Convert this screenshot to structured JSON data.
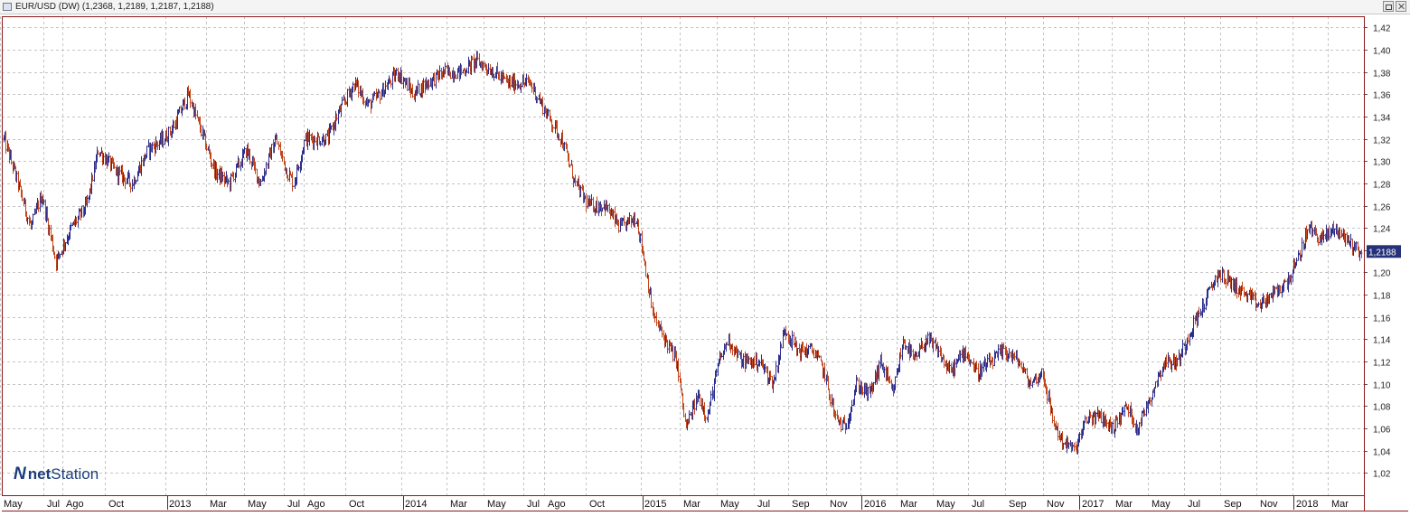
{
  "window": {
    "title": "EUR/USD (DW) (1,2368, 1,2189, 1,2187, 1,2188)"
  },
  "logo": {
    "mark": "N",
    "text_bold": "net",
    "text": "Station"
  },
  "colors": {
    "up_bar": "#2b2f8f",
    "down_bar": "#c2461c",
    "grid": "#c4c4c4",
    "frame": "#8b1a1a",
    "price_label_bg": "#25327a"
  },
  "chart_data": {
    "type": "ohlc",
    "symbol": "EUR/USD (DW)",
    "ohlc_last": {
      "open": 1.2368,
      "high": 1.2189,
      "low": 1.2187,
      "close": 1.2188
    },
    "last_price_label": "1,2188",
    "ylim": [
      1.0,
      1.43
    ],
    "y_ticks": [
      "1,02",
      "1,04",
      "1,06",
      "1,08",
      "1,10",
      "1,12",
      "1,14",
      "1,16",
      "1,18",
      "1,20",
      "1,22",
      "1,24",
      "1,26",
      "1,28",
      "1,30",
      "1,32",
      "1,34",
      "1,36",
      "1,38",
      "1,40",
      "1,42"
    ],
    "grid": true,
    "x_ticks": [
      "May",
      "Jul",
      "Ago",
      "Oct",
      "2013",
      "Mar",
      "May",
      "Jul",
      "Ago",
      "Oct",
      "2014",
      "Mar",
      "May",
      "Jul",
      "Ago",
      "Oct",
      "2015",
      "Mar",
      "May",
      "Jul",
      "Sep",
      "Nov",
      "2016",
      "Mar",
      "May",
      "Jul",
      "Sep",
      "Nov",
      "2017",
      "Mar",
      "May",
      "Jul",
      "Sep",
      "Nov",
      "2018",
      "Mar"
    ],
    "keypoints": [
      [
        0.0,
        1.32
      ],
      [
        0.012,
        1.29
      ],
      [
        0.03,
        1.24
      ],
      [
        0.042,
        1.27
      ],
      [
        0.058,
        1.21
      ],
      [
        0.075,
        1.24
      ],
      [
        0.092,
        1.26
      ],
      [
        0.105,
        1.31
      ],
      [
        0.125,
        1.29
      ],
      [
        0.143,
        1.28
      ],
      [
        0.16,
        1.31
      ],
      [
        0.178,
        1.32
      ],
      [
        0.188,
        1.33
      ],
      [
        0.205,
        1.36
      ],
      [
        0.218,
        1.33
      ],
      [
        0.235,
        1.29
      ],
      [
        0.25,
        1.28
      ],
      [
        0.27,
        1.31
      ],
      [
        0.285,
        1.28
      ],
      [
        0.302,
        1.32
      ],
      [
        0.315,
        1.29
      ],
      [
        0.322,
        1.28
      ],
      [
        0.335,
        1.32
      ],
      [
        0.36,
        1.32
      ],
      [
        0.37,
        1.34
      ],
      [
        0.39,
        1.37
      ],
      [
        0.405,
        1.35
      ],
      [
        0.418,
        1.36
      ],
      [
        0.438,
        1.38
      ],
      [
        0.455,
        1.36
      ],
      [
        0.47,
        1.37
      ],
      [
        0.49,
        1.38
      ],
      [
        0.508,
        1.38
      ],
      [
        0.525,
        1.39
      ],
      [
        0.545,
        1.38
      ],
      [
        0.56,
        1.37
      ],
      [
        0.585,
        1.37
      ],
      [
        0.605,
        1.34
      ],
      [
        0.62,
        1.32
      ],
      [
        0.635,
        1.28
      ],
      [
        0.65,
        1.26
      ],
      [
        0.668,
        1.26
      ],
      [
        0.685,
        1.24
      ],
      [
        0.703,
        1.25
      ],
      [
        0.712,
        1.21
      ],
      [
        0.722,
        1.16
      ],
      [
        0.735,
        1.14
      ],
      [
        0.748,
        1.12
      ],
      [
        0.758,
        1.06
      ],
      [
        0.772,
        1.09
      ],
      [
        0.782,
        1.07
      ],
      [
        0.795,
        1.12
      ],
      [
        0.805,
        1.14
      ],
      [
        0.82,
        1.12
      ],
      [
        0.84,
        1.12
      ],
      [
        0.855,
        1.1
      ],
      [
        0.868,
        1.15
      ],
      [
        0.882,
        1.13
      ],
      [
        0.9,
        1.13
      ],
      [
        0.912,
        1.11
      ],
      [
        0.924,
        1.07
      ],
      [
        0.935,
        1.06
      ],
      [
        0.948,
        1.1
      ],
      [
        0.962,
        1.09
      ],
      [
        0.975,
        1.12
      ],
      [
        0.988,
        1.09
      ],
      [
        1.0,
        1.14
      ],
      [
        1.012,
        1.12
      ],
      [
        1.025,
        1.14
      ],
      [
        1.038,
        1.13
      ],
      [
        1.052,
        1.11
      ],
      [
        1.068,
        1.13
      ],
      [
        1.082,
        1.11
      ],
      [
        1.098,
        1.12
      ],
      [
        1.112,
        1.13
      ],
      [
        1.128,
        1.12
      ],
      [
        1.14,
        1.1
      ],
      [
        1.155,
        1.11
      ],
      [
        1.165,
        1.07
      ],
      [
        1.175,
        1.05
      ],
      [
        1.19,
        1.04
      ],
      [
        1.205,
        1.07
      ],
      [
        1.22,
        1.07
      ],
      [
        1.232,
        1.06
      ],
      [
        1.248,
        1.08
      ],
      [
        1.26,
        1.06
      ],
      [
        1.275,
        1.09
      ],
      [
        1.29,
        1.12
      ],
      [
        1.305,
        1.12
      ],
      [
        1.32,
        1.15
      ],
      [
        1.333,
        1.17
      ],
      [
        1.35,
        1.2
      ],
      [
        1.365,
        1.19
      ],
      [
        1.38,
        1.18
      ],
      [
        1.395,
        1.17
      ],
      [
        1.41,
        1.18
      ],
      [
        1.425,
        1.19
      ],
      [
        1.438,
        1.21
      ],
      [
        1.45,
        1.24
      ],
      [
        1.465,
        1.23
      ],
      [
        1.48,
        1.24
      ],
      [
        1.492,
        1.23
      ],
      [
        1.505,
        1.22
      ],
      [
        1.51,
        1.2188
      ]
    ]
  }
}
